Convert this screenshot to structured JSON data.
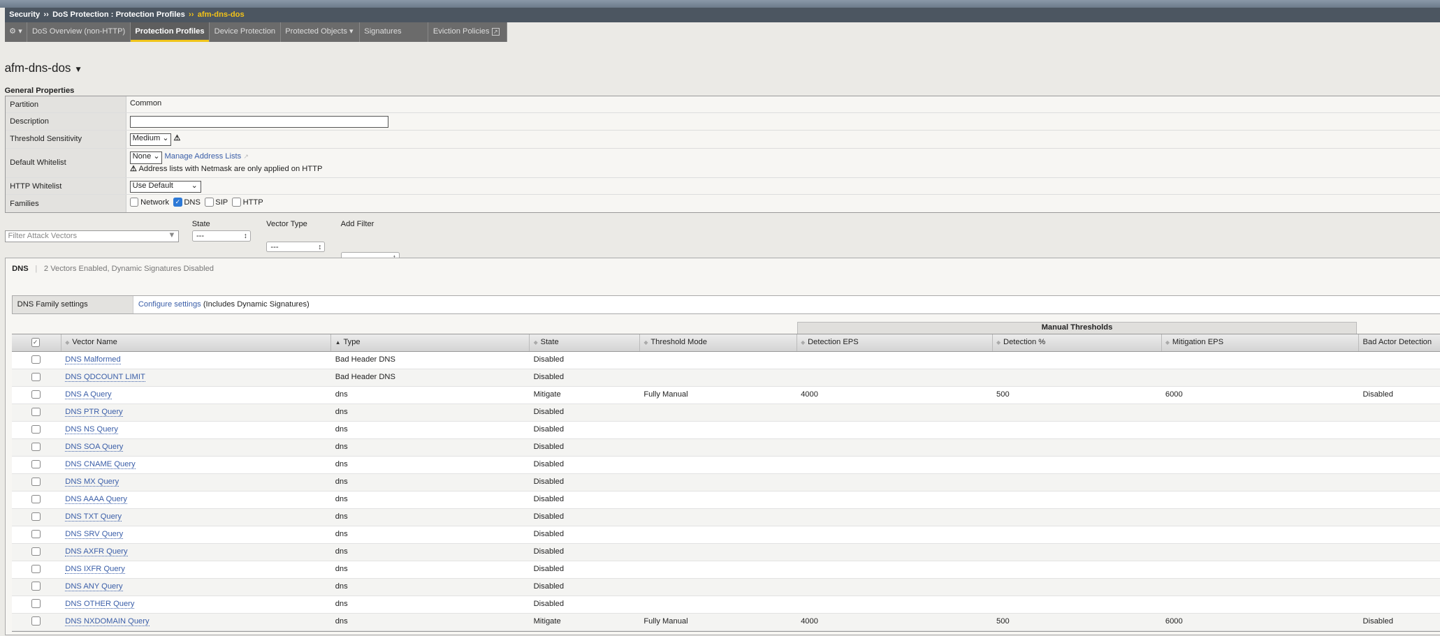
{
  "breadcrumb": {
    "items": [
      "Security",
      "DoS Protection : Protection Profiles"
    ],
    "current": "afm-dns-dos",
    "sep": "››"
  },
  "tabs": [
    {
      "label": "DoS Overview (non-HTTP)"
    },
    {
      "label": "Protection Profiles",
      "active": true
    },
    {
      "label": "Device Protection"
    },
    {
      "label": "Protected Objects",
      "dropdown": true
    },
    {
      "label": "Signatures"
    },
    {
      "label": "Eviction Policies",
      "external": true
    }
  ],
  "page_title": "afm-dns-dos",
  "general": {
    "title": "General Properties",
    "partition_label": "Partition",
    "partition": "Common",
    "description_label": "Description",
    "description": "",
    "sensitivity_label": "Threshold Sensitivity",
    "sensitivity": "Medium",
    "whitelist_label": "Default Whitelist",
    "whitelist": "None",
    "manage_link": "Manage Address Lists",
    "whitelist_note": "Address lists with Netmask are only applied on HTTP",
    "http_whitelist_label": "HTTP Whitelist",
    "http_whitelist": "Use Default",
    "families_label": "Families",
    "families": [
      {
        "label": "Network",
        "checked": false
      },
      {
        "label": "DNS",
        "checked": true
      },
      {
        "label": "SIP",
        "checked": false
      },
      {
        "label": "HTTP",
        "checked": false
      }
    ]
  },
  "filters": {
    "placeholder": "Filter Attack Vectors",
    "state_label": "State",
    "state": "---",
    "vtype_label": "Vector Type",
    "vtype": "---",
    "add_label": "Add Filter",
    "add": ""
  },
  "dns": {
    "name": "DNS",
    "summary": "2 Vectors Enabled, Dynamic Signatures Disabled",
    "family_label": "DNS Family settings",
    "configure_link": "Configure settings",
    "configure_note": " (Includes Dynamic Signatures)"
  },
  "table": {
    "group_header": "Manual Thresholds",
    "columns": [
      "Vector Name",
      "Type",
      "State",
      "Threshold Mode",
      "Detection EPS",
      "Detection %",
      "Mitigation EPS",
      "Bad Actor Detection"
    ],
    "rows": [
      [
        "DNS Malformed",
        "Bad Header DNS",
        "Disabled",
        "",
        "",
        "",
        "",
        ""
      ],
      [
        "DNS QDCOUNT LIMIT",
        "Bad Header DNS",
        "Disabled",
        "",
        "",
        "",
        "",
        ""
      ],
      [
        "DNS A Query",
        "dns",
        "Mitigate",
        "Fully Manual",
        "4000",
        "500",
        "6000",
        "Disabled"
      ],
      [
        "DNS PTR Query",
        "dns",
        "Disabled",
        "",
        "",
        "",
        "",
        ""
      ],
      [
        "DNS NS Query",
        "dns",
        "Disabled",
        "",
        "",
        "",
        "",
        ""
      ],
      [
        "DNS SOA Query",
        "dns",
        "Disabled",
        "",
        "",
        "",
        "",
        ""
      ],
      [
        "DNS CNAME Query",
        "dns",
        "Disabled",
        "",
        "",
        "",
        "",
        ""
      ],
      [
        "DNS MX Query",
        "dns",
        "Disabled",
        "",
        "",
        "",
        "",
        ""
      ],
      [
        "DNS AAAA Query",
        "dns",
        "Disabled",
        "",
        "",
        "",
        "",
        ""
      ],
      [
        "DNS TXT Query",
        "dns",
        "Disabled",
        "",
        "",
        "",
        "",
        ""
      ],
      [
        "DNS SRV Query",
        "dns",
        "Disabled",
        "",
        "",
        "",
        "",
        ""
      ],
      [
        "DNS AXFR Query",
        "dns",
        "Disabled",
        "",
        "",
        "",
        "",
        ""
      ],
      [
        "DNS IXFR Query",
        "dns",
        "Disabled",
        "",
        "",
        "",
        "",
        ""
      ],
      [
        "DNS ANY Query",
        "dns",
        "Disabled",
        "",
        "",
        "",
        "",
        ""
      ],
      [
        "DNS OTHER Query",
        "dns",
        "Disabled",
        "",
        "",
        "",
        "",
        ""
      ],
      [
        "DNS NXDOMAIN Query",
        "dns",
        "Mitigate",
        "Fully Manual",
        "4000",
        "500",
        "6000",
        "Disabled"
      ]
    ]
  }
}
